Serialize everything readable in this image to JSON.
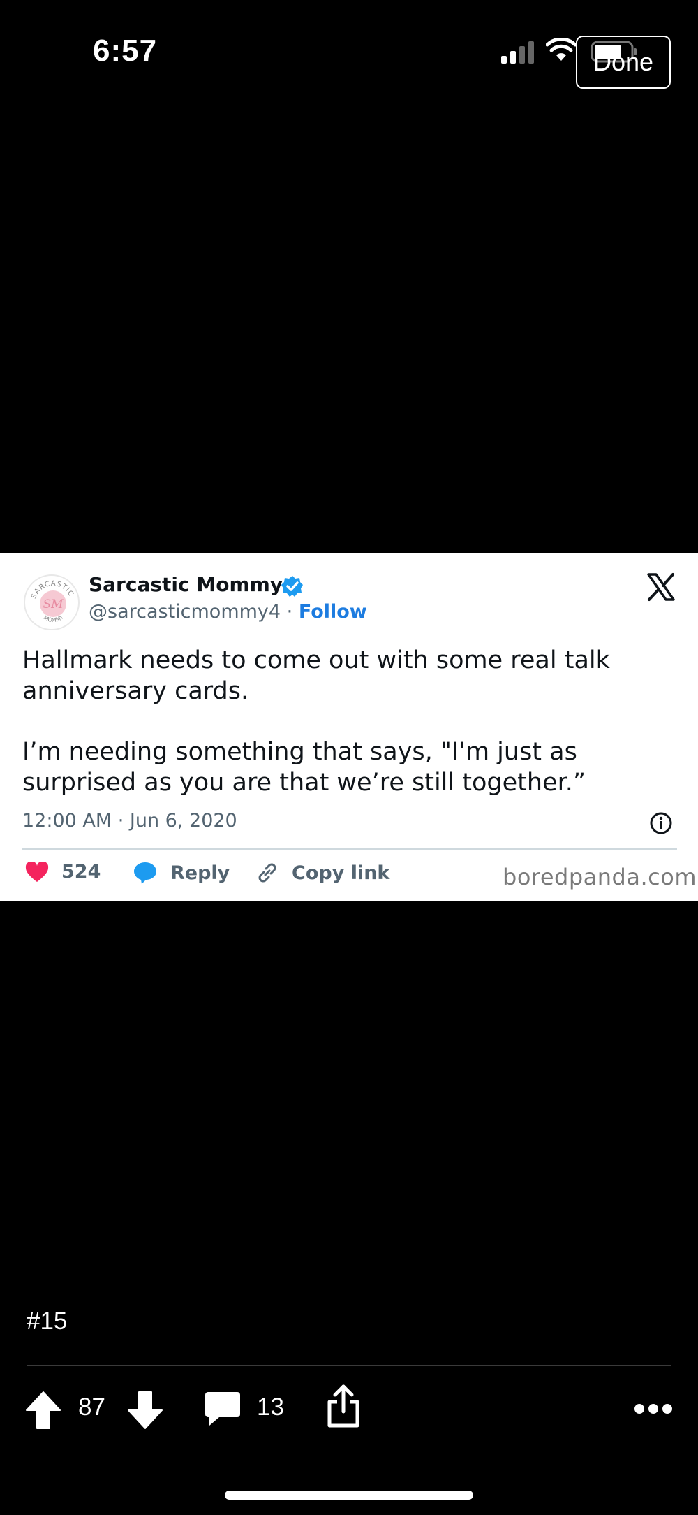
{
  "status_bar": {
    "time": "6:57",
    "icons": [
      "signal-icon",
      "wifi-icon",
      "battery-icon"
    ]
  },
  "viewer": {
    "done_label": "Done"
  },
  "tweet": {
    "author_name": "Sarcastic Mommy",
    "handle": "@sarcasticmommy4",
    "separator": " · ",
    "follow_label": "Follow",
    "avatar": {
      "ring_text_top": "SARCASTIC",
      "ring_text_bottom": "MOMMY",
      "monogram": "SM"
    },
    "text_paragraphs": [
      "Hallmark needs to come out with some real talk anniversary cards.",
      "I’m needing something that says, \"I'm just as surprised as you are that we’re still together.”"
    ],
    "timestamp": "12:00 AM · Jun 6, 2020",
    "likes": "524",
    "reply_label": "Reply",
    "copy_link_label": "Copy link",
    "source": "boredpanda.com",
    "colors": {
      "like": "#f4245e",
      "reply": "#1d9bf0",
      "follow": "#1d7ce0",
      "verified": "#1d9bf0"
    }
  },
  "post": {
    "number": "#15",
    "upvotes": "87",
    "comments": "13"
  }
}
